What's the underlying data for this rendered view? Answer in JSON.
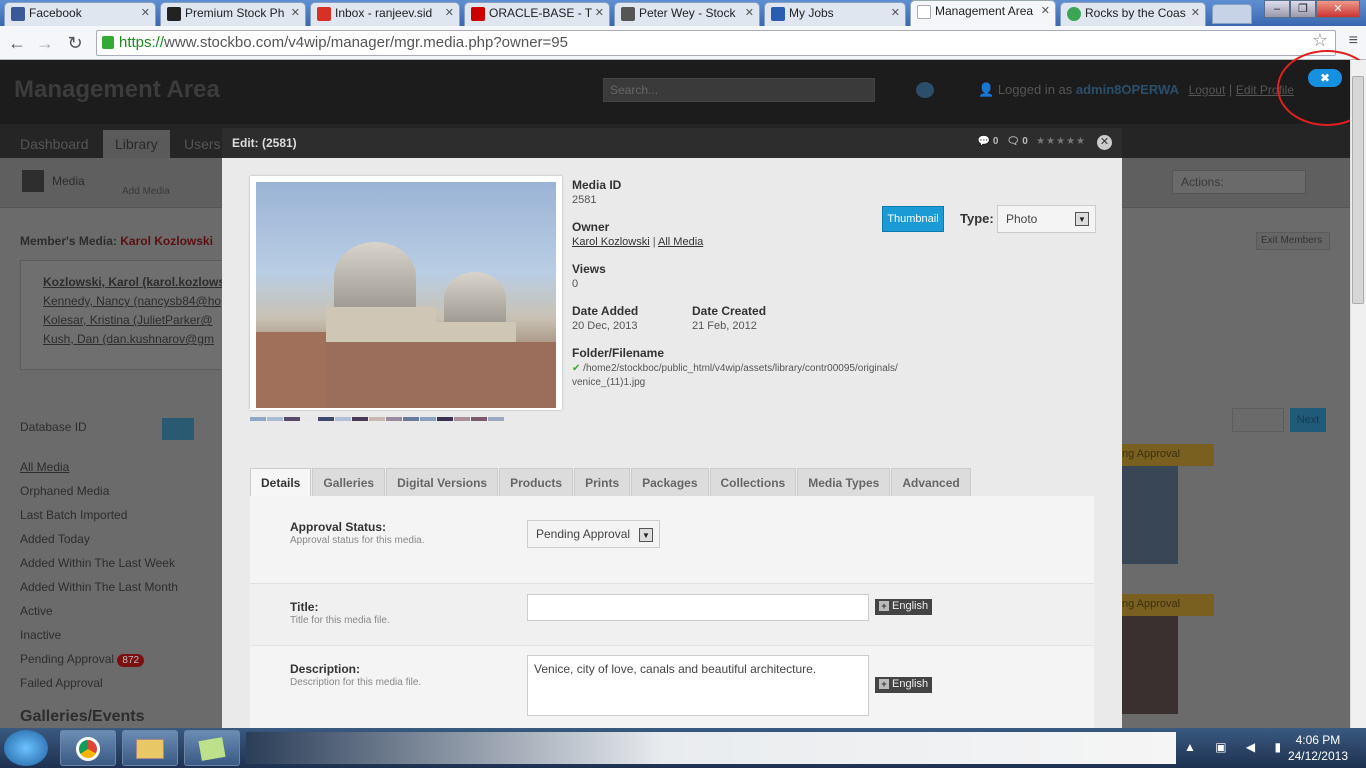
{
  "browser": {
    "tabs": [
      {
        "label": "Facebook",
        "color": "#3b5998"
      },
      {
        "label": "Premium Stock Ph",
        "color": "#222222"
      },
      {
        "label": "Inbox - ranjeev.sid",
        "color": "#d93025"
      },
      {
        "label": "ORACLE-BASE - T",
        "color": "#cc0000"
      },
      {
        "label": "Peter Wey - Stock",
        "color": "#555555"
      },
      {
        "label": "My Jobs",
        "color": "#2a5db0"
      },
      {
        "label": "Management Area",
        "color": "#ffffff"
      },
      {
        "label": "Rocks by the Coas",
        "color": "#3aa655"
      }
    ],
    "url_scheme": "https://",
    "url_rest": "www.stockbo.com/v4wip/manager/mgr.media.php?owner=95"
  },
  "page": {
    "title": "Management Area",
    "search_placeholder": "Search...",
    "logged_in_prefix": "Logged in as",
    "username": "admin8OPERWA",
    "logout": "Logout",
    "edit_profile": "Edit Profile",
    "nav": [
      "Dashboard",
      "Library",
      "Users"
    ],
    "toolbar": {
      "media": "Media",
      "add_media": "Add Media",
      "actions": "Actions:"
    },
    "members_media_label": "Member's Media:",
    "member_name": "Karol Kozlowski",
    "exit_members": "Exit Members",
    "members": [
      "Kozlowski, Karol (karol.kozlows",
      "Kennedy, Nancy (nancysb84@ho",
      "Kolesar, Kristina (JulietParker@",
      "Kush, Dan (dan.kushnarov@gm"
    ],
    "db_sort": "Database ID",
    "sidebar": [
      "All Media",
      "Orphaned Media",
      "Last Batch Imported",
      "Added Today",
      "Added Within The Last Week",
      "Added Within The Last Month",
      "Active",
      "Inactive",
      "Pending Approval",
      "Failed Approval"
    ],
    "pending_count": "872",
    "galleries_heading": "Galleries/Events",
    "card_label": "ng Approval",
    "next": "Next"
  },
  "modal": {
    "title": "Edit: (2581)",
    "comments": "0",
    "messages": "0",
    "rating": "★★★★★",
    "media_id_label": "Media ID",
    "media_id": "2581",
    "owner_label": "Owner",
    "owner": "Karol Kozlowski",
    "all_media": "All Media",
    "views_label": "Views",
    "views": "0",
    "date_added_label": "Date Added",
    "date_added": "20 Dec, 2013",
    "date_created_label": "Date Created",
    "date_created": "21 Feb, 2012",
    "folder_label": "Folder/Filename",
    "folder_path": "/home2/stockboc/public_html/v4wip/assets/library/contr00095/originals/",
    "filename": "venice_(11)1.jpg",
    "thumbnail_btn": "Thumbnail",
    "type_label": "Type:",
    "type_value": "Photo",
    "swatches": [
      "#8fa8c8",
      "#a8bcd6",
      "#5a4a6a",
      "#e8e8e8",
      "#3d4a6e",
      "#b0c0d8",
      "#4a3a5a",
      "#c8b8b0",
      "#9a8aa0",
      "#6a7a9a",
      "#8aa0c0",
      "#3a3050",
      "#a89098",
      "#7a5a6a",
      "#9aa8c0"
    ],
    "tabs": [
      "Details",
      "Galleries",
      "Digital Versions",
      "Products",
      "Prints",
      "Packages",
      "Collections",
      "Media Types",
      "Advanced"
    ],
    "approval_label": "Approval Status:",
    "approval_help": "Approval status for this media.",
    "approval_value": "Pending Approval",
    "title_label": "Title:",
    "title_help": "Title for this media file.",
    "title_value": "",
    "desc_label": "Description:",
    "desc_help": "Description for this media file.",
    "desc_value": "Venice, city of love, canals and beautiful architecture.",
    "lang_btn": "English"
  },
  "taskbar": {
    "time": "4:06 PM",
    "date": "24/12/2013"
  }
}
